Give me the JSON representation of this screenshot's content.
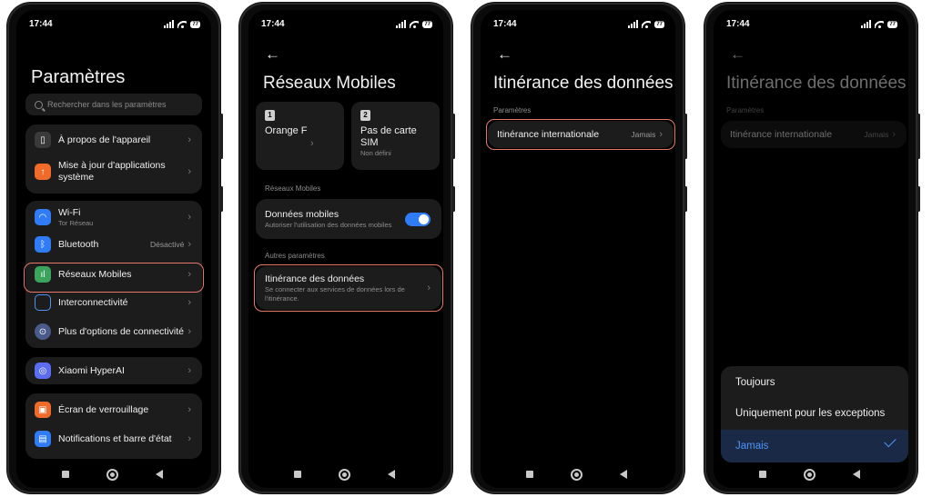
{
  "status_time": "17:44",
  "battery": "77",
  "screen1": {
    "title": "Paramètres",
    "search_placeholder": "Rechercher dans les paramètres",
    "group1": [
      {
        "label": "À propos de l'appareil",
        "icon": "phone-info-icon",
        "color": "#3a3a3a"
      },
      {
        "label": "Mise à jour d'applications système",
        "icon": "update-arrow-icon",
        "color": "#f06a2a"
      }
    ],
    "group2": [
      {
        "label": "Wi-Fi",
        "sub": "Tor Réseau",
        "icon": "wifi-icon",
        "color": "#2f7cf6"
      },
      {
        "label": "Bluetooth",
        "value": "Désactivé",
        "icon": "bluetooth-icon",
        "color": "#2f7cf6"
      },
      {
        "label": "Réseaux Mobiles",
        "icon": "mobile-network-icon",
        "color": "#3aa35c"
      },
      {
        "label": "Interconnectivité",
        "icon": "interconnect-icon",
        "color": "#1c1c1c"
      },
      {
        "label": "Plus d'options de connectivité",
        "icon": "connectivity-icon",
        "color": "#4a5a8a"
      }
    ],
    "group3": [
      {
        "label": "Xiaomi HyperAI",
        "icon": "hyperai-icon",
        "color": "#5b6df0"
      }
    ],
    "group4": [
      {
        "label": "Écran de verrouillage",
        "icon": "lock-icon",
        "color": "#f06a2a"
      },
      {
        "label": "Notifications et barre d'état",
        "icon": "notification-icon",
        "color": "#2f7cf6"
      }
    ]
  },
  "screen2": {
    "title": "Réseaux Mobiles",
    "sim1": {
      "num": "1",
      "name": "Orange F"
    },
    "sim2": {
      "num": "2",
      "name": "Pas de carte SIM",
      "sub": "Non défini"
    },
    "section1": "Réseaux Mobiles",
    "mobile_data": {
      "label": "Données mobiles",
      "sub": "Autoriser l'utilisation des données mobiles"
    },
    "section2": "Autres paramètres",
    "roaming": {
      "label": "Itinérance des données",
      "sub": "Se connecter aux services de données lors de l'itinérance."
    }
  },
  "screen3": {
    "title": "Itinérance des données",
    "section": "Paramètres",
    "intl_label": "Itinérance internationale",
    "intl_value": "Jamais"
  },
  "screen4": {
    "title": "Itinérance des données",
    "section": "Paramètres",
    "intl_label": "Itinérance internationale",
    "intl_value": "Jamais",
    "options": [
      "Toujours",
      "Uniquement pour les exceptions",
      "Jamais"
    ],
    "selected": "Jamais"
  },
  "colors": {
    "accent": "#2f7cf6",
    "highlight": "#e8776a"
  }
}
